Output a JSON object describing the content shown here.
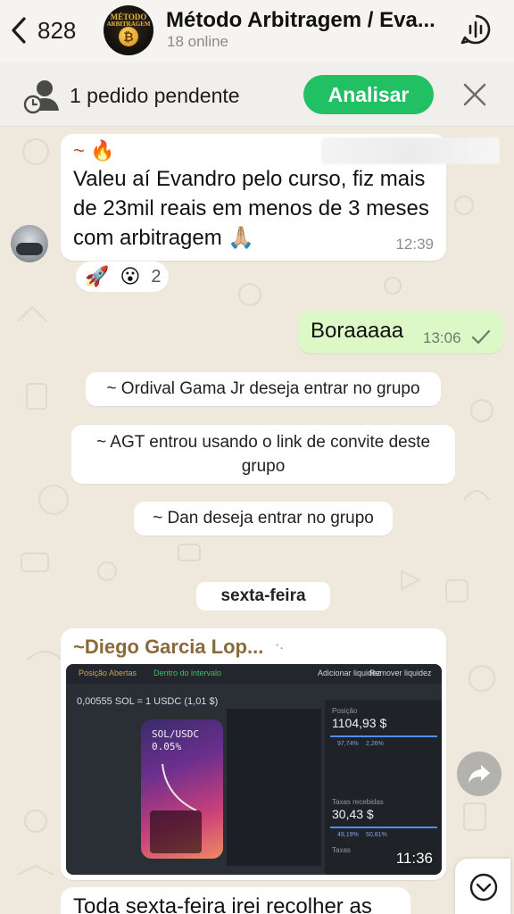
{
  "header": {
    "back_icon": "chevron-left-icon",
    "unread_count": "828",
    "group_name": "Método Arbitragem / Eva...",
    "online_status": "18 online",
    "avatar_text_top": "MÉTODO",
    "avatar_text_bottom": "ARBITRAGEM",
    "voice_icon": "voice-chat-icon"
  },
  "pending_bar": {
    "icon": "pending-user-icon",
    "text": "1 pedido pendente",
    "action_label": "Analisar",
    "close_icon": "close-icon",
    "accent": "#21c063"
  },
  "messages": [
    {
      "sender": "~ 🔥",
      "text": "Valeu aí Evandro pelo curso, fiz mais de 23mil reais em menos de 3 meses com arbitragem 🙏🏼",
      "time": "12:39",
      "reactions": [
        "🚀",
        "😮"
      ],
      "reaction_count": "2"
    },
    {
      "text": "Boraaaaa",
      "time": "13:06",
      "status_icon": "check-icon"
    }
  ],
  "system_messages": [
    "~ Ordival Gama Jr deseja entrar no grupo",
    "~ AGT entrou usando o link de convite deste grupo",
    "~ Dan deseja entrar no grupo"
  ],
  "date_divider": "sexta-feira",
  "media_message": {
    "sender": "~Diego Garcia Lop...",
    "sender_suffix": "·.",
    "time": "11:36",
    "screenshot": {
      "tab_1": "Posição Abertas",
      "tab_2": "Dentro do intervalo",
      "action_1": "Adicionar liquidez",
      "action_2": "Remover liquidez",
      "rate": "0,00555 SOL = 1 USDC (1,01 $)",
      "pair": "SOL/USDC",
      "fee": "0.05%",
      "position_label": "Posição",
      "position_value": "1104,93 $",
      "position_split_a": "97,74%",
      "position_split_b": "2,26%",
      "fees_label": "Taxas recebidas",
      "fees_value": "30,43 $",
      "fees_split_a": "49,19%",
      "fees_split_b": "50,81%",
      "rewards_label": "Taxas"
    }
  },
  "partial_message": {
    "text": "Toda sexta-feira irei recolher as"
  },
  "share_icon": "share-arrow-icon",
  "scroll_icon": "chevron-down-icon"
}
